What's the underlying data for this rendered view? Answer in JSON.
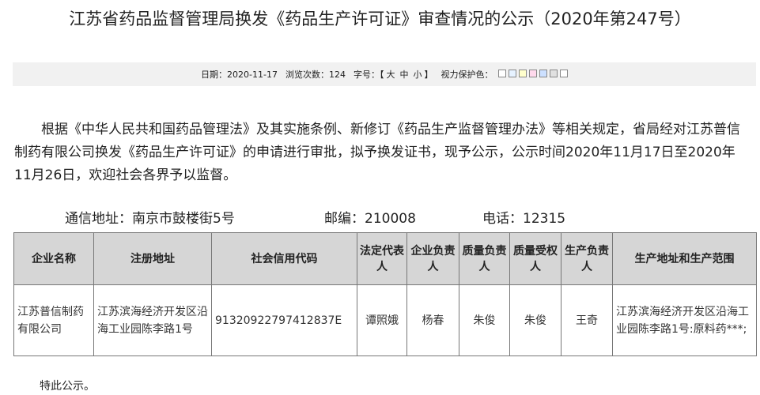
{
  "title": "江苏省药品监督管理局换发《药品生产许可证》审查情况的公示（2020年第247号）",
  "info": {
    "date_label": "日期：",
    "date": "2020-11-17",
    "views_label": "浏览次数：",
    "views": "124",
    "fontsize_label": "字号：",
    "fontsize_open": "【",
    "fontsize_options": [
      "大",
      "中",
      "小"
    ],
    "fontsize_close": "】",
    "eye_label": "视力保护色：",
    "eye_colors": [
      "#ffffff",
      "#e6f2ff",
      "#ffffcc",
      "#ffd9ec",
      "#cce0ff",
      "#e0e0e0",
      "#ffffff"
    ]
  },
  "body_text": "根据《中华人民共和国药品管理法》及其实施条例、新修订《药品生产监督管理办法》等相关规定，省局经对江苏普信制药有限公司换发《药品生产许可证》的申请进行审批，拟予换发证书，现予公示，公示时间2020年11月17日至2020年11月26日，欢迎社会各界予以监督。",
  "contact": {
    "address": "通信地址：南京市鼓楼街5号",
    "postcode": "邮编：210008",
    "phone": "电话：12315"
  },
  "table": {
    "headers": [
      "企业名称",
      "注册地址",
      "社会信用代码",
      "法定代表人",
      "企业负责人",
      "质量负责人",
      "质量受权人",
      "生产负责人",
      "生产地址和生产范围"
    ],
    "rows": [
      [
        "江苏普信制药有限公司",
        "江苏滨海经济开发区沿海工业园陈李路1号",
        "91320922797412837E",
        "谭照娥",
        "杨春",
        "朱俊",
        "朱俊",
        "王奇",
        "江苏滨海经济开发区沿海工业园陈李路1号:原料药***;"
      ]
    ]
  },
  "footer": "特此公示。"
}
